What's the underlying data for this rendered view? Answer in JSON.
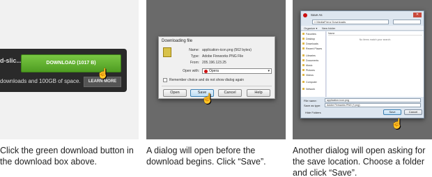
{
  "panel1": {
    "filename_fragment": "d-slic...",
    "download_button": "DOWNLOAD (1017 B)",
    "space_text": "downloads and 100GB of space.",
    "learn_more": "LEARN MORE"
  },
  "panel2": {
    "title": "Downloading file",
    "name_label": "Name:",
    "name_value": "application-icon.png (562 bytes)",
    "type_label": "Type:",
    "type_value": "Adobe Fireworks PNG File",
    "from_label": "From:",
    "from_value": "205.196.123.25",
    "open_with_label": "Open with:",
    "open_with_value": "Opera",
    "remember_label": "Remember choice and do not show dialog again",
    "buttons": [
      "Open",
      "Save",
      "Cancel",
      "Help"
    ]
  },
  "panel3": {
    "title": "Save As",
    "address": "« MediaFire ▸ Downloads",
    "organize": "Organize ▾",
    "new_folder": "New folder",
    "nav_items": [
      "Favorites",
      "Desktop",
      "Downloads",
      "Recent Places",
      "Libraries",
      "Documents",
      "Music",
      "Pictures",
      "Videos",
      "Computer",
      "Network"
    ],
    "column_header": "Name",
    "empty_text": "No items match your search.",
    "file_name_label": "File name:",
    "file_name_value": "application-icon.png",
    "save_as_type_label": "Save as type:",
    "save_as_type_value": "Adobe Fireworks PNG (*.png)",
    "hide_folders": "Hide Folders",
    "save_button": "Save",
    "cancel_button": "Cancel"
  },
  "captions": [
    "Click the green download button in the download box above.",
    "A dialog will open before the download begins. Click “Save”.",
    "Another dialog will open asking for the save location. Choose a folder and click “Save”."
  ],
  "icons": {
    "cursor": "hand-pointer-icon",
    "file": "png-file-icon",
    "browser": "opera-icon"
  },
  "colors": {
    "download_green": "#5fae2e",
    "dark_box": "#2a2a2a",
    "panel_gray": "#6a6a6a"
  }
}
